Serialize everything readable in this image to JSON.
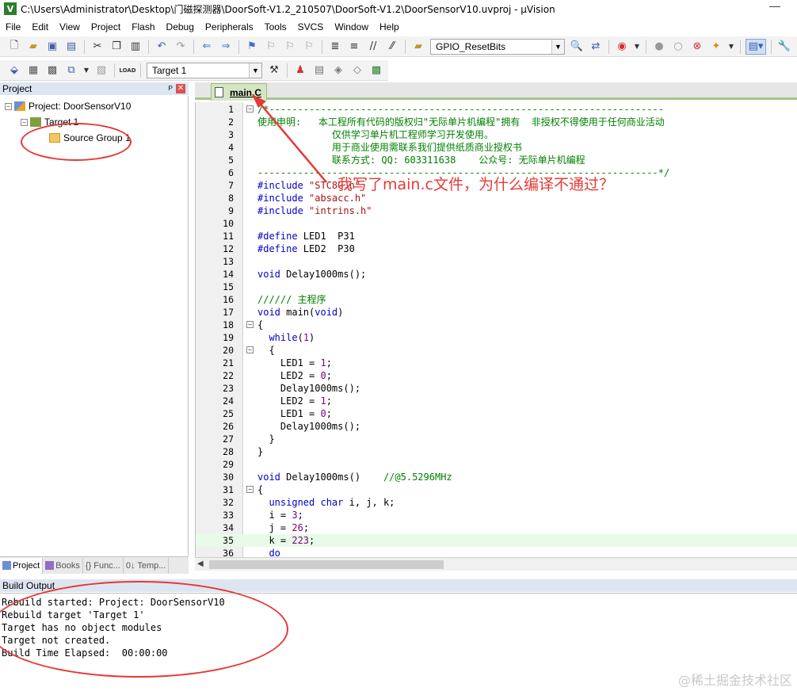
{
  "window": {
    "title": "C:\\Users\\Administrator\\Desktop\\门磁探测器\\DoorSoft-V1.2_210507\\DoorSoft-V1.2\\DoorSensorV10.uvproj - µVision",
    "app_icon_letter": "V",
    "minimize_glyph": "—"
  },
  "menu": [
    "File",
    "Edit",
    "View",
    "Project",
    "Flash",
    "Debug",
    "Peripherals",
    "Tools",
    "SVCS",
    "Window",
    "Help"
  ],
  "toolbar": {
    "function_combo": "GPIO_ResetBits",
    "target_combo": "Target 1",
    "load_label": "LOAD"
  },
  "project_pane": {
    "title": "Project",
    "pin_glyph": "ᴘ",
    "close_glyph": "✕",
    "tree": [
      {
        "label": "Project: DoorSensorV10",
        "expander": "−"
      },
      {
        "label": "Target 1",
        "expander": "−"
      },
      {
        "label": "Source Group 1",
        "expander": ""
      }
    ],
    "tabs": [
      "Project",
      "Books",
      "{} Func...",
      "0↓ Temp..."
    ]
  },
  "editor": {
    "active_tab": "main.C",
    "lines": [
      {
        "n": "1",
        "fold": "−",
        "segs": [
          {
            "t": "/*---------------------------------------------------------------------",
            "c": "c-cm"
          }
        ]
      },
      {
        "n": "2",
        "fold": "",
        "segs": [
          {
            "t": "使用申明:   本工程所有代码的版权归\"无际单片机编程\"拥有  非授权不得使用于任何商业活动",
            "c": "c-cm"
          }
        ]
      },
      {
        "n": "3",
        "fold": "",
        "segs": [
          {
            "t": "             仅供学习单片机工程师学习开发使用。",
            "c": "c-cm"
          }
        ]
      },
      {
        "n": "4",
        "fold": "",
        "segs": [
          {
            "t": "             用于商业使用需联系我们提供纸质商业授权书",
            "c": "c-cm"
          }
        ]
      },
      {
        "n": "5",
        "fold": "",
        "segs": [
          {
            "t": "             联系方式: QQ: 603311638    公众号: 无际单片机编程",
            "c": "c-cm"
          }
        ]
      },
      {
        "n": "6",
        "fold": "",
        "segs": [
          {
            "t": "----------------------------------------------------------------------*/",
            "c": "c-cm"
          }
        ]
      },
      {
        "n": "7",
        "fold": "",
        "segs": [
          {
            "t": "#include ",
            "c": "c-kw"
          },
          {
            "t": "\"STC8G.h\"",
            "c": "c-st"
          }
        ]
      },
      {
        "n": "8",
        "fold": "",
        "segs": [
          {
            "t": "#include ",
            "c": "c-kw"
          },
          {
            "t": "\"absacc.h\"",
            "c": "c-st"
          }
        ]
      },
      {
        "n": "9",
        "fold": "",
        "segs": [
          {
            "t": "#include ",
            "c": "c-kw"
          },
          {
            "t": "\"intrins.h\"",
            "c": "c-st"
          }
        ]
      },
      {
        "n": "10",
        "fold": "",
        "segs": []
      },
      {
        "n": "11",
        "fold": "",
        "segs": [
          {
            "t": "#define ",
            "c": "c-kw"
          },
          {
            "t": "LED1  P31",
            "c": "c-pl"
          }
        ]
      },
      {
        "n": "12",
        "fold": "",
        "segs": [
          {
            "t": "#define ",
            "c": "c-kw"
          },
          {
            "t": "LED2  P30",
            "c": "c-pl"
          }
        ]
      },
      {
        "n": "13",
        "fold": "",
        "segs": []
      },
      {
        "n": "14",
        "fold": "",
        "segs": [
          {
            "t": "void ",
            "c": "c-kw"
          },
          {
            "t": "Delay1000ms();",
            "c": "c-pl"
          }
        ]
      },
      {
        "n": "15",
        "fold": "",
        "segs": []
      },
      {
        "n": "16",
        "fold": "",
        "segs": [
          {
            "t": "////// 主程序",
            "c": "c-cm"
          }
        ]
      },
      {
        "n": "17",
        "fold": "",
        "segs": [
          {
            "t": "void ",
            "c": "c-kw"
          },
          {
            "t": "main(",
            "c": "c-pl"
          },
          {
            "t": "void",
            "c": "c-kw"
          },
          {
            "t": ")",
            "c": "c-pl"
          }
        ]
      },
      {
        "n": "18",
        "fold": "−",
        "segs": [
          {
            "t": "{",
            "c": "c-pl"
          }
        ]
      },
      {
        "n": "19",
        "fold": "",
        "segs": [
          {
            "t": "  ",
            "c": "c-pl"
          },
          {
            "t": "while",
            "c": "c-kw"
          },
          {
            "t": "(",
            "c": "c-pl"
          },
          {
            "t": "1",
            "c": "c-nm"
          },
          {
            "t": ")",
            "c": "c-pl"
          }
        ]
      },
      {
        "n": "20",
        "fold": "−",
        "segs": [
          {
            "t": "  {",
            "c": "c-pl"
          }
        ]
      },
      {
        "n": "21",
        "fold": "",
        "segs": [
          {
            "t": "    LED1 = ",
            "c": "c-pl"
          },
          {
            "t": "1",
            "c": "c-nm"
          },
          {
            "t": ";",
            "c": "c-pl"
          }
        ]
      },
      {
        "n": "22",
        "fold": "",
        "segs": [
          {
            "t": "    LED2 = ",
            "c": "c-pl"
          },
          {
            "t": "0",
            "c": "c-nm"
          },
          {
            "t": ";",
            "c": "c-pl"
          }
        ]
      },
      {
        "n": "23",
        "fold": "",
        "segs": [
          {
            "t": "    Delay1000ms();",
            "c": "c-pl"
          }
        ]
      },
      {
        "n": "24",
        "fold": "",
        "segs": [
          {
            "t": "    LED2 = ",
            "c": "c-pl"
          },
          {
            "t": "1",
            "c": "c-nm"
          },
          {
            "t": ";",
            "c": "c-pl"
          }
        ]
      },
      {
        "n": "25",
        "fold": "",
        "segs": [
          {
            "t": "    LED1 = ",
            "c": "c-pl"
          },
          {
            "t": "0",
            "c": "c-nm"
          },
          {
            "t": ";",
            "c": "c-pl"
          }
        ]
      },
      {
        "n": "26",
        "fold": "",
        "segs": [
          {
            "t": "    Delay1000ms();",
            "c": "c-pl"
          }
        ]
      },
      {
        "n": "27",
        "fold": "",
        "segs": [
          {
            "t": "  }",
            "c": "c-pl"
          }
        ]
      },
      {
        "n": "28",
        "fold": "",
        "segs": [
          {
            "t": "}",
            "c": "c-pl"
          }
        ]
      },
      {
        "n": "29",
        "fold": "",
        "segs": []
      },
      {
        "n": "30",
        "fold": "",
        "segs": [
          {
            "t": "void ",
            "c": "c-kw"
          },
          {
            "t": "Delay1000ms()    ",
            "c": "c-pl"
          },
          {
            "t": "//@5.5296MHz",
            "c": "c-cm"
          }
        ]
      },
      {
        "n": "31",
        "fold": "−",
        "segs": [
          {
            "t": "{",
            "c": "c-pl"
          }
        ]
      },
      {
        "n": "32",
        "fold": "",
        "segs": [
          {
            "t": "  ",
            "c": "c-pl"
          },
          {
            "t": "unsigned char ",
            "c": "c-kw"
          },
          {
            "t": "i, j, k;",
            "c": "c-pl"
          }
        ]
      },
      {
        "n": "33",
        "fold": "",
        "segs": [
          {
            "t": "  i = ",
            "c": "c-pl"
          },
          {
            "t": "3",
            "c": "c-nm"
          },
          {
            "t": ";",
            "c": "c-pl"
          }
        ]
      },
      {
        "n": "34",
        "fold": "",
        "segs": [
          {
            "t": "  j = ",
            "c": "c-pl"
          },
          {
            "t": "26",
            "c": "c-nm"
          },
          {
            "t": ";",
            "c": "c-pl"
          }
        ]
      },
      {
        "n": "35",
        "fold": "",
        "hl": true,
        "segs": [
          {
            "t": "  k = ",
            "c": "c-pl"
          },
          {
            "t": "223",
            "c": "c-nm"
          },
          {
            "t": ";",
            "c": "c-pl"
          }
        ]
      },
      {
        "n": "36",
        "fold": "",
        "segs": [
          {
            "t": "  ",
            "c": "c-pl"
          },
          {
            "t": "do",
            "c": "c-kw"
          }
        ]
      }
    ]
  },
  "build_output": {
    "title": "Build Output",
    "lines": [
      "Rebuild started: Project: DoorSensorV10",
      "Rebuild target 'Target 1'",
      "Target has no object modules",
      "Target not created.",
      "Build Time Elapsed:  00:00:00"
    ]
  },
  "annotation": {
    "question": "我写了main.c文件，为什么编译不通过？",
    "color": "#e53935"
  },
  "watermark": "@稀土掘金技术社区"
}
